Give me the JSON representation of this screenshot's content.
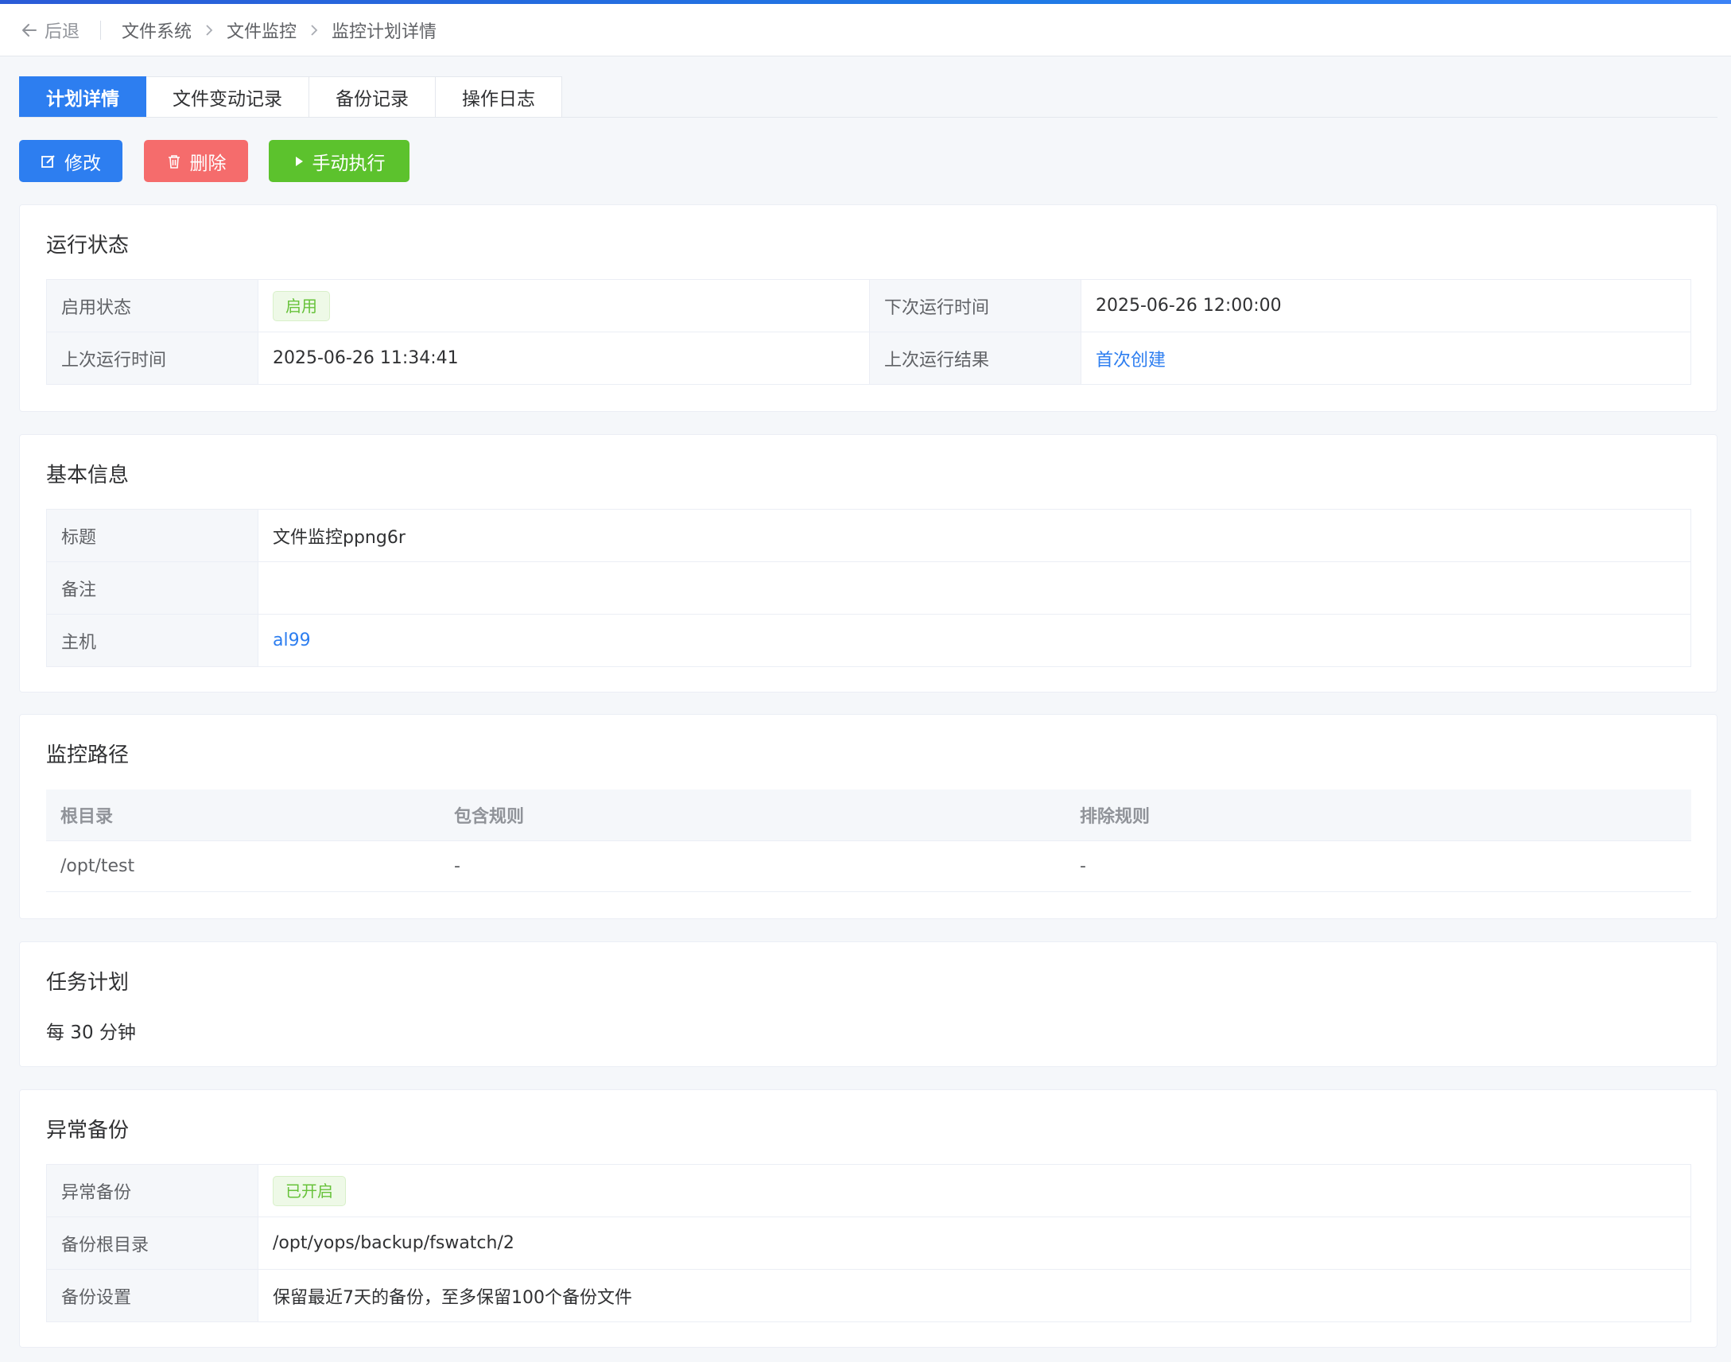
{
  "header": {
    "back_label": "后退",
    "breadcrumbs": [
      "文件系统",
      "文件监控",
      "监控计划详情"
    ]
  },
  "tabs": [
    {
      "label": "计划详情",
      "active": true
    },
    {
      "label": "文件变动记录",
      "active": false
    },
    {
      "label": "备份记录",
      "active": false
    },
    {
      "label": "操作日志",
      "active": false
    }
  ],
  "actions": {
    "edit_label": "修改",
    "delete_label": "删除",
    "run_label": "手动执行"
  },
  "run_status": {
    "title": "运行状态",
    "enabled_label": "启用状态",
    "enabled_value": "启用",
    "next_run_label": "下次运行时间",
    "next_run_value": "2025-06-26 12:00:00",
    "last_run_label": "上次运行时间",
    "last_run_value": "2025-06-26 11:34:41",
    "last_result_label": "上次运行结果",
    "last_result_value": "首次创建"
  },
  "basic_info": {
    "title": "基本信息",
    "rows": [
      {
        "label": "标题",
        "value": "文件监控ppng6r"
      },
      {
        "label": "备注",
        "value": ""
      },
      {
        "label": "主机",
        "value": "al99"
      }
    ]
  },
  "monitor_paths": {
    "title": "监控路径",
    "columns": [
      "根目录",
      "包含规则",
      "排除规则"
    ],
    "rows": [
      [
        "/opt/test",
        "-",
        "-"
      ]
    ]
  },
  "schedule": {
    "title": "任务计划",
    "value": "每 30 分钟"
  },
  "abnormal_backup": {
    "title": "异常备份",
    "rows": [
      {
        "label": "异常备份",
        "value": "已开启"
      },
      {
        "label": "备份根目录",
        "value": "/opt/yops/backup/fswatch/2"
      },
      {
        "label": "备份设置",
        "value": "保留最近7天的备份，至多保留100个备份文件"
      }
    ]
  },
  "colors": {
    "primary": "#2d7ef0",
    "danger": "#f56c6c",
    "success": "#5cc22d",
    "tag_green": "#67c23a"
  }
}
